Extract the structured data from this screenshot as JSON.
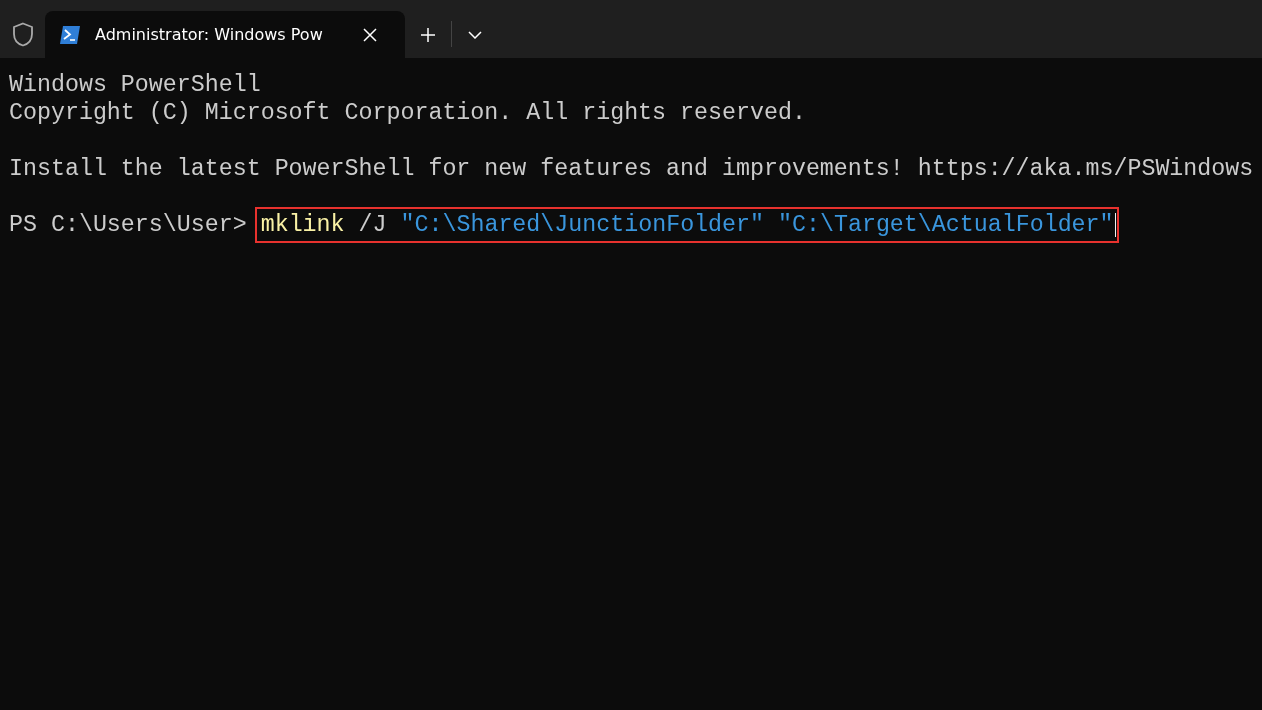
{
  "tab_bar": {
    "tabs": [
      {
        "title": "Administrator: Windows Pow",
        "selected": true
      }
    ]
  },
  "console": {
    "lines": [
      {
        "kind": "output",
        "text": "Windows PowerShell"
      },
      {
        "kind": "output",
        "text": "Copyright (C) Microsoft Corporation. All rights reserved."
      },
      {
        "kind": "blank"
      },
      {
        "kind": "output",
        "text": "Install the latest PowerShell for new features and improvements! https://aka.ms/PSWindows"
      },
      {
        "kind": "blank"
      },
      {
        "kind": "prompt",
        "prompt": "PS C:\\Users\\User>",
        "highlighted": true,
        "tokens": [
          {
            "kind": "command",
            "text": "mklink"
          },
          {
            "kind": "parameter",
            "text": "/J"
          },
          {
            "kind": "string",
            "text": "\"C:\\Shared\\JunctionFolder\""
          },
          {
            "kind": "string",
            "text": "\"C:\\Target\\ActualFolder\""
          }
        ]
      }
    ]
  }
}
